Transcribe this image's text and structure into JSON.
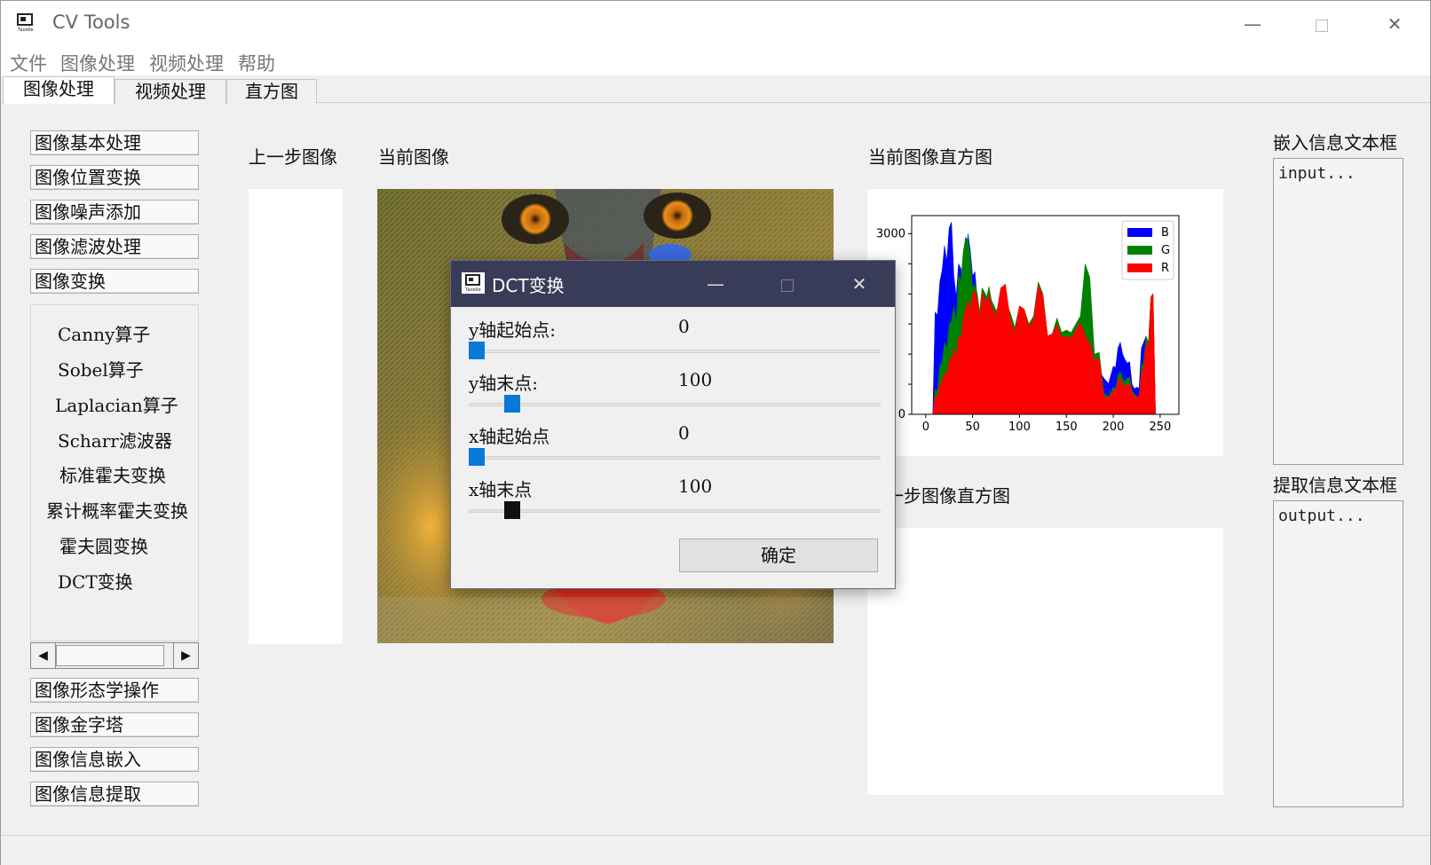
{
  "window": {
    "title": "CV Tools",
    "minimize": "—",
    "close": "✕"
  },
  "menu": [
    "文件",
    "图像处理",
    "视频处理",
    "帮助"
  ],
  "tabs": [
    "图像处理",
    "视频处理",
    "直方图"
  ],
  "left_buttons_top": [
    "图像基本处理",
    "图像位置变换",
    "图像噪声添加",
    "图像滤波处理",
    "图像变换"
  ],
  "left_list": [
    "Canny算子",
    "Sobel算子",
    "Laplacian算子",
    "Scharr滤波器",
    "标准霍夫变换",
    "累计概率霍夫变换",
    "霍夫圆变换",
    "DCT变换"
  ],
  "left_buttons_bottom": [
    "图像形态学操作",
    "图像金字塔",
    "图像信息嵌入",
    "图像信息提取"
  ],
  "scroll": {
    "left_arrow": "◀",
    "right_arrow": "▶"
  },
  "labels": {
    "prev_image": "上一步图像",
    "current_image": "当前图像",
    "current_hist": "当前图像直方图",
    "prev_hist": "上一步图像直方图",
    "embed_box": "嵌入信息文本框",
    "extract_box": "提取信息文本框"
  },
  "text_boxes": {
    "input_placeholder": "input...",
    "output_placeholder": "output..."
  },
  "dialog": {
    "title": "DCT变换",
    "minimize": "—",
    "close": "✕",
    "rows": [
      {
        "label": "y轴起始点:",
        "value": "0",
        "fraction": 0.0
      },
      {
        "label": "y轴末点:",
        "value": "100",
        "fraction": 0.2
      },
      {
        "label": "x轴起始点",
        "value": "0",
        "fraction": 0.0
      },
      {
        "label": "x轴末点",
        "value": "100",
        "fraction": 0.2
      }
    ],
    "ok": "确定"
  },
  "colors": {
    "dialog_title_bg": "#393c58",
    "slider_thumb": "#0a78d7",
    "hist_b": "#0000ff",
    "hist_g": "#008000",
    "hist_r": "#ff0000"
  },
  "chart_data": {
    "type": "area",
    "title": "",
    "xlabel": "",
    "ylabel": "",
    "xlim": [
      -15,
      270
    ],
    "ylim": [
      0,
      3300
    ],
    "x_ticks": [
      0,
      50,
      100,
      150,
      200,
      250
    ],
    "y_ticks": [
      0,
      500,
      1000,
      1500,
      2000,
      2500,
      3000
    ],
    "y_tick_labels_visible": [
      "0",
      "",
      "",
      "",
      "",
      "",
      "3000"
    ],
    "legend": {
      "position": "top-right",
      "entries": [
        "B",
        "G",
        "R"
      ]
    },
    "series": [
      {
        "name": "B",
        "color": "#0000ff",
        "x": [
          5,
          10,
          15,
          20,
          25,
          30,
          35,
          40,
          45,
          50,
          55,
          60,
          65,
          70,
          80,
          90,
          100,
          110,
          120,
          130,
          140,
          150,
          160,
          170,
          180,
          190,
          200,
          205,
          210,
          215,
          220,
          225,
          230,
          235,
          240,
          245
        ],
        "values": [
          0,
          1700,
          2200,
          2800,
          3100,
          2300,
          2500,
          1700,
          3000,
          2300,
          1900,
          2000,
          1900,
          1800,
          1700,
          1400,
          1500,
          1300,
          1700,
          1200,
          1300,
          1200,
          1100,
          1000,
          700,
          600,
          800,
          1100,
          1000,
          850,
          500,
          450,
          1100,
          1300,
          1900,
          0
        ]
      },
      {
        "name": "G",
        "color": "#008000",
        "x": [
          5,
          10,
          15,
          20,
          25,
          30,
          35,
          40,
          45,
          50,
          55,
          60,
          65,
          70,
          80,
          90,
          100,
          110,
          120,
          130,
          140,
          150,
          160,
          170,
          180,
          190,
          200,
          205,
          210,
          215,
          220,
          225,
          230,
          235,
          240,
          245
        ],
        "values": [
          0,
          400,
          800,
          1200,
          1500,
          1800,
          2300,
          2700,
          2900,
          2100,
          2000,
          2100,
          1950,
          1900,
          1800,
          1700,
          1800,
          1500,
          2200,
          1300,
          1600,
          1400,
          1500,
          2500,
          1000,
          350,
          450,
          650,
          600,
          600,
          400,
          300,
          800,
          1300,
          1900,
          0
        ]
      },
      {
        "name": "R",
        "color": "#ff0000",
        "x": [
          5,
          10,
          15,
          20,
          25,
          30,
          35,
          40,
          45,
          50,
          55,
          60,
          65,
          70,
          80,
          90,
          100,
          110,
          120,
          130,
          140,
          150,
          160,
          170,
          180,
          190,
          200,
          205,
          210,
          215,
          220,
          225,
          230,
          235,
          240,
          245
        ],
        "values": [
          0,
          300,
          500,
          700,
          900,
          1100,
          1300,
          1600,
          1900,
          2000,
          1900,
          2000,
          1850,
          1800,
          2100,
          1600,
          1800,
          1450,
          2150,
          1300,
          1500,
          1300,
          1400,
          1300,
          900,
          300,
          400,
          550,
          500,
          500,
          350,
          300,
          700,
          1200,
          1950,
          0
        ]
      }
    ]
  }
}
